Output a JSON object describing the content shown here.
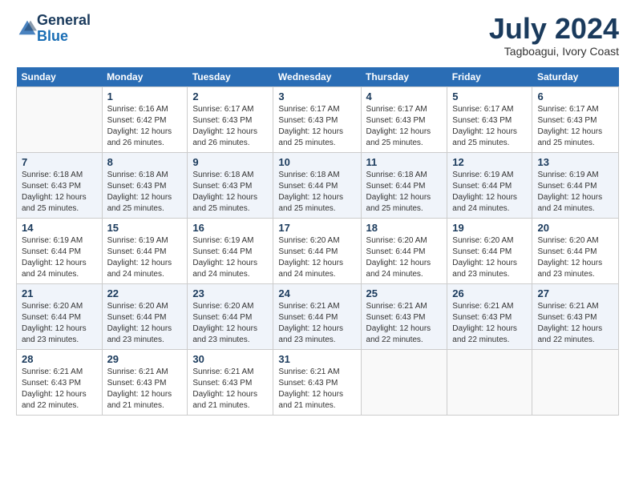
{
  "header": {
    "logo_general": "General",
    "logo_blue": "Blue",
    "title": "July 2024",
    "subtitle": "Tagboagui, Ivory Coast"
  },
  "weekdays": [
    "Sunday",
    "Monday",
    "Tuesday",
    "Wednesday",
    "Thursday",
    "Friday",
    "Saturday"
  ],
  "weeks": [
    [
      {
        "num": "",
        "info": ""
      },
      {
        "num": "1",
        "info": "Sunrise: 6:16 AM\nSunset: 6:42 PM\nDaylight: 12 hours\nand 26 minutes."
      },
      {
        "num": "2",
        "info": "Sunrise: 6:17 AM\nSunset: 6:43 PM\nDaylight: 12 hours\nand 26 minutes."
      },
      {
        "num": "3",
        "info": "Sunrise: 6:17 AM\nSunset: 6:43 PM\nDaylight: 12 hours\nand 25 minutes."
      },
      {
        "num": "4",
        "info": "Sunrise: 6:17 AM\nSunset: 6:43 PM\nDaylight: 12 hours\nand 25 minutes."
      },
      {
        "num": "5",
        "info": "Sunrise: 6:17 AM\nSunset: 6:43 PM\nDaylight: 12 hours\nand 25 minutes."
      },
      {
        "num": "6",
        "info": "Sunrise: 6:17 AM\nSunset: 6:43 PM\nDaylight: 12 hours\nand 25 minutes."
      }
    ],
    [
      {
        "num": "7",
        "info": "Sunrise: 6:18 AM\nSunset: 6:43 PM\nDaylight: 12 hours\nand 25 minutes."
      },
      {
        "num": "8",
        "info": "Sunrise: 6:18 AM\nSunset: 6:43 PM\nDaylight: 12 hours\nand 25 minutes."
      },
      {
        "num": "9",
        "info": "Sunrise: 6:18 AM\nSunset: 6:43 PM\nDaylight: 12 hours\nand 25 minutes."
      },
      {
        "num": "10",
        "info": "Sunrise: 6:18 AM\nSunset: 6:44 PM\nDaylight: 12 hours\nand 25 minutes."
      },
      {
        "num": "11",
        "info": "Sunrise: 6:18 AM\nSunset: 6:44 PM\nDaylight: 12 hours\nand 25 minutes."
      },
      {
        "num": "12",
        "info": "Sunrise: 6:19 AM\nSunset: 6:44 PM\nDaylight: 12 hours\nand 24 minutes."
      },
      {
        "num": "13",
        "info": "Sunrise: 6:19 AM\nSunset: 6:44 PM\nDaylight: 12 hours\nand 24 minutes."
      }
    ],
    [
      {
        "num": "14",
        "info": "Sunrise: 6:19 AM\nSunset: 6:44 PM\nDaylight: 12 hours\nand 24 minutes."
      },
      {
        "num": "15",
        "info": "Sunrise: 6:19 AM\nSunset: 6:44 PM\nDaylight: 12 hours\nand 24 minutes."
      },
      {
        "num": "16",
        "info": "Sunrise: 6:19 AM\nSunset: 6:44 PM\nDaylight: 12 hours\nand 24 minutes."
      },
      {
        "num": "17",
        "info": "Sunrise: 6:20 AM\nSunset: 6:44 PM\nDaylight: 12 hours\nand 24 minutes."
      },
      {
        "num": "18",
        "info": "Sunrise: 6:20 AM\nSunset: 6:44 PM\nDaylight: 12 hours\nand 24 minutes."
      },
      {
        "num": "19",
        "info": "Sunrise: 6:20 AM\nSunset: 6:44 PM\nDaylight: 12 hours\nand 23 minutes."
      },
      {
        "num": "20",
        "info": "Sunrise: 6:20 AM\nSunset: 6:44 PM\nDaylight: 12 hours\nand 23 minutes."
      }
    ],
    [
      {
        "num": "21",
        "info": "Sunrise: 6:20 AM\nSunset: 6:44 PM\nDaylight: 12 hours\nand 23 minutes."
      },
      {
        "num": "22",
        "info": "Sunrise: 6:20 AM\nSunset: 6:44 PM\nDaylight: 12 hours\nand 23 minutes."
      },
      {
        "num": "23",
        "info": "Sunrise: 6:20 AM\nSunset: 6:44 PM\nDaylight: 12 hours\nand 23 minutes."
      },
      {
        "num": "24",
        "info": "Sunrise: 6:21 AM\nSunset: 6:44 PM\nDaylight: 12 hours\nand 23 minutes."
      },
      {
        "num": "25",
        "info": "Sunrise: 6:21 AM\nSunset: 6:43 PM\nDaylight: 12 hours\nand 22 minutes."
      },
      {
        "num": "26",
        "info": "Sunrise: 6:21 AM\nSunset: 6:43 PM\nDaylight: 12 hours\nand 22 minutes."
      },
      {
        "num": "27",
        "info": "Sunrise: 6:21 AM\nSunset: 6:43 PM\nDaylight: 12 hours\nand 22 minutes."
      }
    ],
    [
      {
        "num": "28",
        "info": "Sunrise: 6:21 AM\nSunset: 6:43 PM\nDaylight: 12 hours\nand 22 minutes."
      },
      {
        "num": "29",
        "info": "Sunrise: 6:21 AM\nSunset: 6:43 PM\nDaylight: 12 hours\nand 21 minutes."
      },
      {
        "num": "30",
        "info": "Sunrise: 6:21 AM\nSunset: 6:43 PM\nDaylight: 12 hours\nand 21 minutes."
      },
      {
        "num": "31",
        "info": "Sunrise: 6:21 AM\nSunset: 6:43 PM\nDaylight: 12 hours\nand 21 minutes."
      },
      {
        "num": "",
        "info": ""
      },
      {
        "num": "",
        "info": ""
      },
      {
        "num": "",
        "info": ""
      }
    ]
  ]
}
